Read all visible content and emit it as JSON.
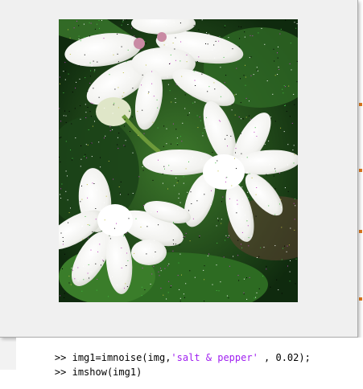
{
  "command_window": {
    "lines": [
      {
        "prompt": ">>",
        "code_before": "img1=imnoise(img,",
        "string_arg": "'salt & pepper'",
        "code_after": " , 0.02);"
      },
      {
        "prompt": ">>",
        "code_before": "imshow(img1)",
        "string_arg": "",
        "code_after": ""
      }
    ]
  },
  "figure": {
    "image_description_icon": "flower-image",
    "noise_type": "salt & pepper",
    "noise_density": 0.02
  },
  "colors": {
    "figure_bg": "#f0f0f0",
    "string_literal": "#a020f0",
    "editor_marker": "#e07a1f"
  }
}
